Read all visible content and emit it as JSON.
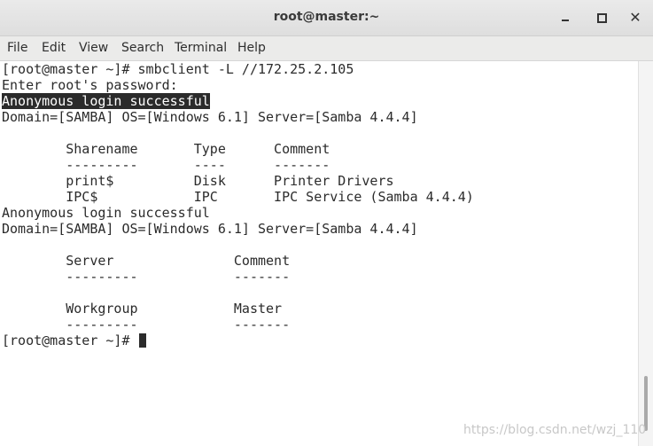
{
  "window": {
    "title": "root@master:~",
    "close_glyph": "✕"
  },
  "menubar": {
    "items": [
      "File",
      "Edit",
      "View",
      "Search",
      "Terminal",
      "Help"
    ]
  },
  "terminal": {
    "lines": [
      "[root@master ~]# smbclient -L //172.25.2.105",
      "Enter root's password:",
      "Anonymous login successful",
      "Domain=[SAMBA] OS=[Windows 6.1] Server=[Samba 4.4.4]",
      "",
      "        Sharename       Type      Comment",
      "        ---------       ----      -------",
      "        print$          Disk      Printer Drivers",
      "        IPC$            IPC       IPC Service (Samba 4.4.4)",
      "Anonymous login successful",
      "Domain=[SAMBA] OS=[Windows 6.1] Server=[Samba 4.4.4]",
      "",
      "        Server               Comment",
      "        ---------            -------",
      "",
      "        Workgroup            Master",
      "        ---------            -------",
      "[root@master ~]# "
    ]
  },
  "watermark": "https://blog.csdn.net/wzj_110",
  "icons": {
    "minimize": "minimize-icon",
    "maximize": "maximize-icon",
    "close": "close-icon"
  }
}
